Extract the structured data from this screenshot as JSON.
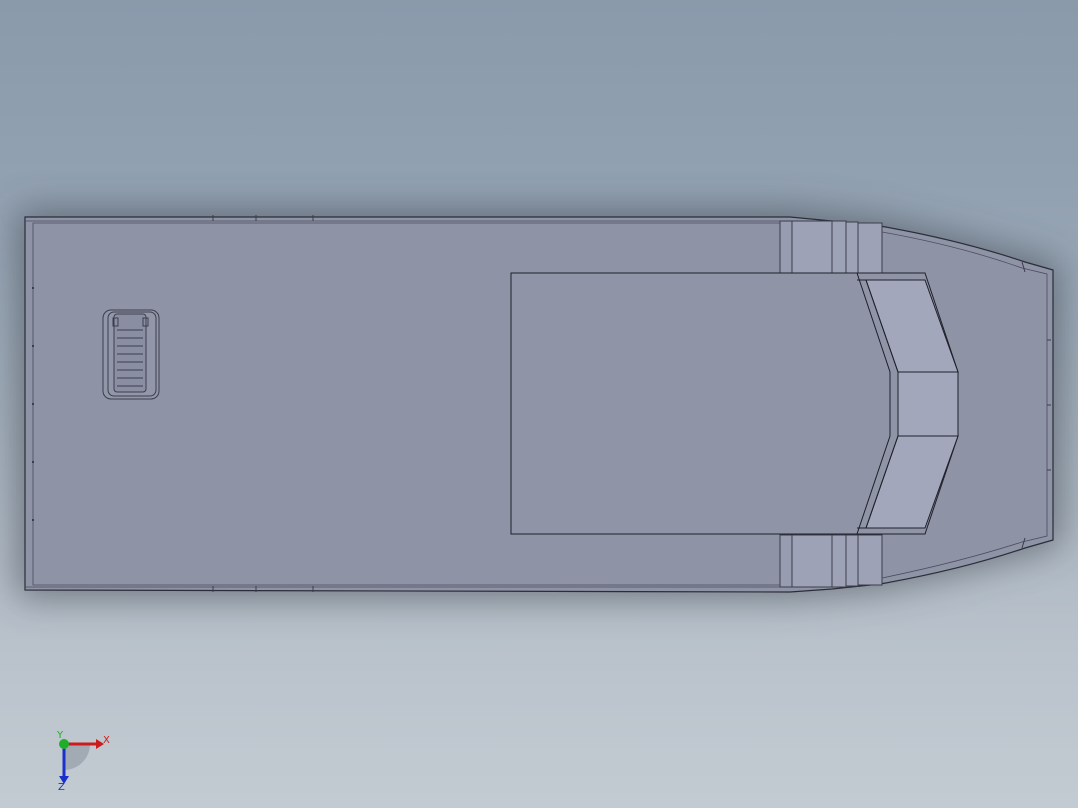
{
  "triad": {
    "x_label": "X",
    "y_label": "Y",
    "z_label": "Z",
    "x_color": "#cc1b1b",
    "y_color": "#1fae2a",
    "z_color": "#1b2fcc"
  },
  "colors": {
    "hull_fill": "#8e93a6",
    "hull_edge": "#2b2d38",
    "cabin_fill": "#8f94a7",
    "windshield_fill": "#a3a7bb",
    "background_top": "#8a9aab",
    "background_bottom": "#c3cbd2"
  }
}
